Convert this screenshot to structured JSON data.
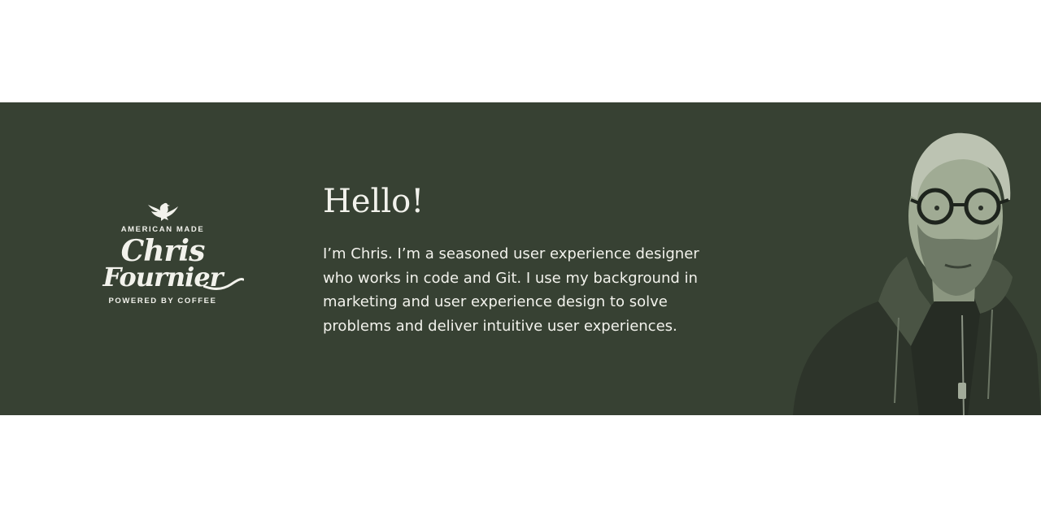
{
  "logo": {
    "top_line": "AMERICAN MADE",
    "first_name": "Chris",
    "last_name": "Fournier",
    "bottom_line": "POWERED BY COFFEE"
  },
  "hero": {
    "greeting": "Hello!",
    "intro": "I’m Chris. I’m a seasoned user experience designer who works in code and Git. I use my background in marketing and user experience design to solve problems and deliver intuitive user experiences."
  },
  "icons": {
    "logo_emblem": "eagle-icon",
    "photo": "portrait-photo"
  },
  "colors": {
    "band": "#374133",
    "text": "#f2f2ec",
    "page": "#ffffff"
  }
}
